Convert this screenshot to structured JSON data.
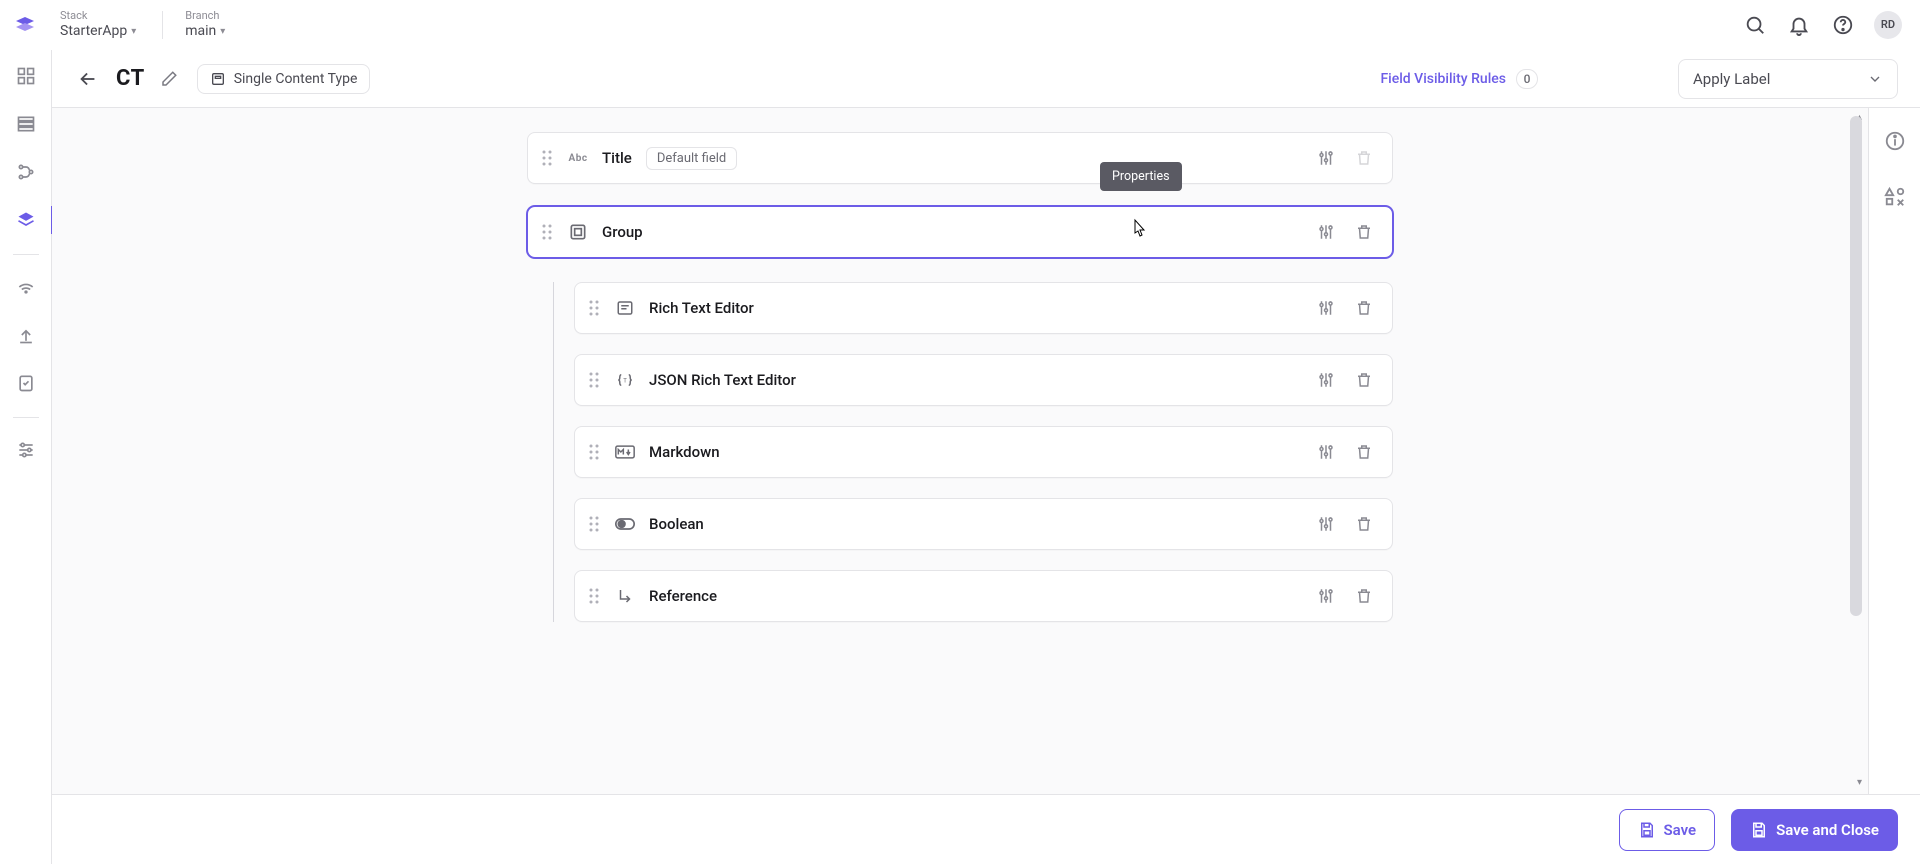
{
  "header": {
    "stack_label": "Stack",
    "stack_value": "StarterApp",
    "branch_label": "Branch",
    "branch_value": "main",
    "avatar_initials": "RD"
  },
  "subheader": {
    "content_type_abbrev": "CT",
    "type_chip_label": "Single Content Type",
    "fvr_label": "Field Visibility Rules",
    "fvr_count": "0",
    "apply_label_text": "Apply Label"
  },
  "fields": {
    "title": {
      "icon_text": "Abc",
      "label": "Title",
      "default_chip": "Default field"
    },
    "group": {
      "label": "Group"
    },
    "children": [
      {
        "label": "Rich Text Editor"
      },
      {
        "label": "JSON Rich Text Editor"
      },
      {
        "label": "Markdown"
      },
      {
        "label": "Boolean"
      },
      {
        "label": "Reference"
      }
    ]
  },
  "tooltip": {
    "properties": "Properties"
  },
  "footer": {
    "save": "Save",
    "save_close": "Save and Close"
  }
}
